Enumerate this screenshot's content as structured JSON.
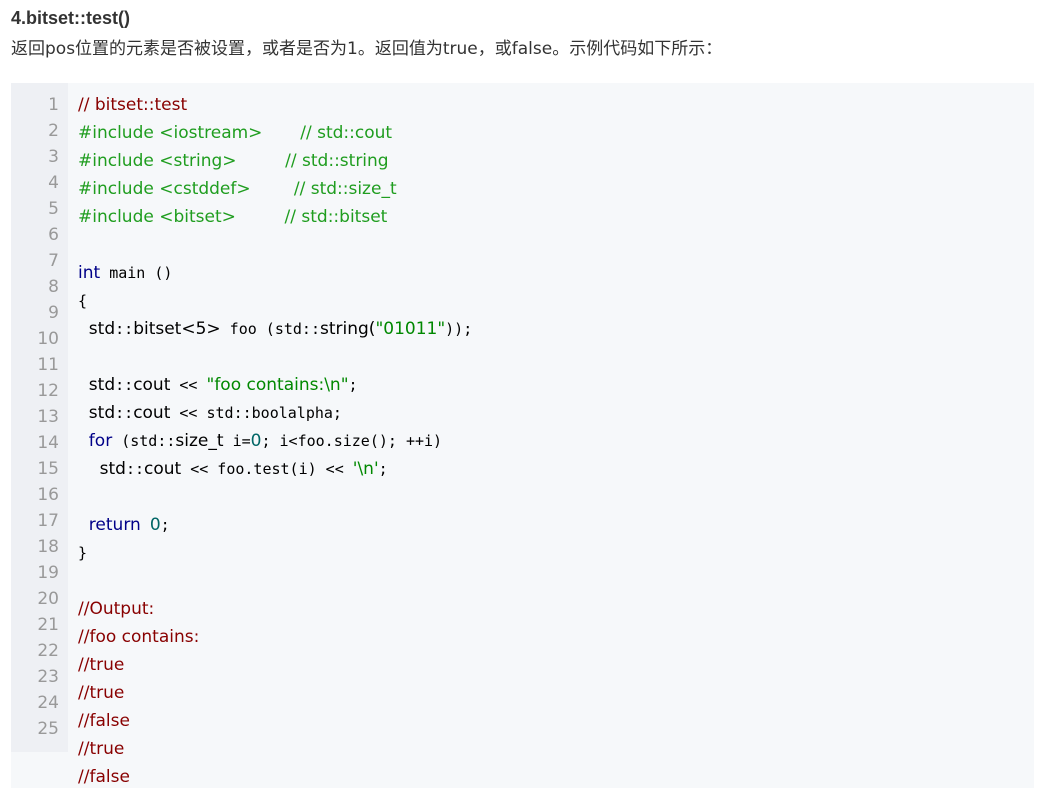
{
  "heading": "4.bitset::test()",
  "description": "返回pos位置的元素是否被设置，或者是否为1。返回值为true，或false。示例代码如下所示：",
  "colors": {
    "comment": "#880000",
    "preprocessor": "#1f9d1f",
    "keyword": "#000088",
    "string": "#008800",
    "number": "#006666",
    "block_background": "#f6f8fa",
    "gutter_background": "#eef0f4",
    "line_number": "#999999"
  },
  "code": {
    "language": "cpp",
    "line_numbers": [
      "1",
      "2",
      "3",
      "4",
      "5",
      "6",
      "7",
      "8",
      "9",
      "10",
      "11",
      "12",
      "13",
      "14",
      "15",
      "16",
      "17",
      "18",
      "19",
      "20",
      "21",
      "22",
      "23",
      "24",
      "25"
    ],
    "lines": [
      [
        {
          "t": "// bitset::test",
          "c": "com"
        }
      ],
      [
        {
          "t": "#include <iostream>       // std::cout",
          "c": "pre"
        }
      ],
      [
        {
          "t": "#include <string>         // std::string",
          "c": "pre"
        }
      ],
      [
        {
          "t": "#include <cstddef>        // std::size_t",
          "c": "pre"
        }
      ],
      [
        {
          "t": "#include <bitset>         // std::bitset",
          "c": "pre"
        }
      ],
      [],
      [
        {
          "t": "int",
          "c": "kw"
        },
        {
          "t": " main ()",
          "c": "mono"
        }
      ],
      [
        {
          "t": "{",
          "c": "mono"
        }
      ],
      [
        {
          "t": "  std",
          "c": "pln"
        },
        {
          "t": "::",
          "c": "mono"
        },
        {
          "t": "bitset<5>",
          "c": "pln"
        },
        {
          "t": " foo (std::",
          "c": "mono"
        },
        {
          "t": "string(",
          "c": "pln"
        },
        {
          "t": "\"01011\"",
          "c": "str"
        },
        {
          "t": "));",
          "c": "mono"
        }
      ],
      [],
      [
        {
          "t": "  std",
          "c": "pln"
        },
        {
          "t": "::",
          "c": "mono"
        },
        {
          "t": "cout",
          "c": "pln"
        },
        {
          "t": " << ",
          "c": "mono"
        },
        {
          "t": "\"foo contains:\\n\"",
          "c": "str"
        },
        {
          "t": ";",
          "c": "mono"
        }
      ],
      [
        {
          "t": "  std",
          "c": "pln"
        },
        {
          "t": "::",
          "c": "mono"
        },
        {
          "t": "cout",
          "c": "pln"
        },
        {
          "t": " << std::boolalpha;",
          "c": "mono"
        }
      ],
      [
        {
          "t": "  for",
          "c": "kw"
        },
        {
          "t": " (std::",
          "c": "mono"
        },
        {
          "t": "size_t",
          "c": "pln"
        },
        {
          "t": " i=",
          "c": "mono"
        },
        {
          "t": "0",
          "c": "num"
        },
        {
          "t": "; i<foo.size(); ++i)",
          "c": "mono"
        }
      ],
      [
        {
          "t": "    std",
          "c": "pln"
        },
        {
          "t": "::",
          "c": "mono"
        },
        {
          "t": "cout",
          "c": "pln"
        },
        {
          "t": " << foo.test(i) << ",
          "c": "mono"
        },
        {
          "t": "'\\n'",
          "c": "str"
        },
        {
          "t": ";",
          "c": "mono"
        }
      ],
      [],
      [
        {
          "t": "  return",
          "c": "kw"
        },
        {
          "t": " ",
          "c": "mono"
        },
        {
          "t": "0",
          "c": "num"
        },
        {
          "t": ";",
          "c": "mono"
        }
      ],
      [
        {
          "t": "}",
          "c": "mono"
        }
      ],
      [],
      [
        {
          "t": "//Output:",
          "c": "com"
        }
      ],
      [
        {
          "t": "//foo contains:",
          "c": "com"
        }
      ],
      [
        {
          "t": "//true",
          "c": "com"
        }
      ],
      [
        {
          "t": "//true",
          "c": "com"
        }
      ],
      [
        {
          "t": "//false",
          "c": "com"
        }
      ],
      [
        {
          "t": "//true",
          "c": "com"
        }
      ],
      [
        {
          "t": "//false",
          "c": "com"
        }
      ]
    ]
  }
}
